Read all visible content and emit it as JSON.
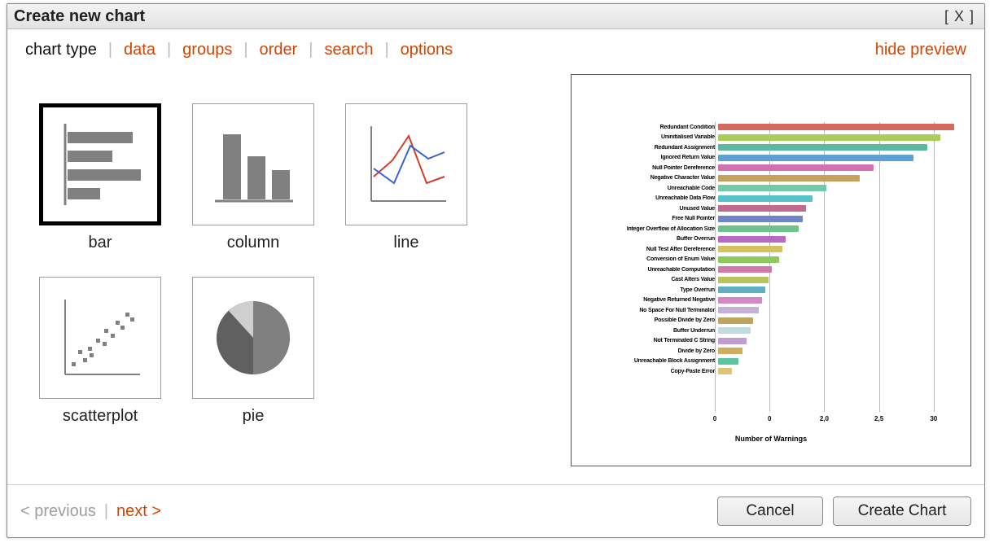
{
  "window": {
    "title": "Create new chart",
    "close_label": "[ X ]"
  },
  "tabs": {
    "items": [
      {
        "id": "chart-type",
        "label": "chart type",
        "active": true
      },
      {
        "id": "data",
        "label": "data"
      },
      {
        "id": "groups",
        "label": "groups"
      },
      {
        "id": "order",
        "label": "order"
      },
      {
        "id": "search",
        "label": "search"
      },
      {
        "id": "options",
        "label": "options"
      }
    ],
    "hide_preview": "hide preview"
  },
  "types": [
    {
      "id": "bar",
      "label": "bar",
      "selected": true
    },
    {
      "id": "column",
      "label": "column"
    },
    {
      "id": "line",
      "label": "line"
    },
    {
      "id": "scatterplot",
      "label": "scatterplot"
    },
    {
      "id": "pie",
      "label": "pie"
    }
  ],
  "nav": {
    "previous": "< previous",
    "next": "next >",
    "cancel": "Cancel",
    "create": "Create Chart"
  },
  "chart_data": {
    "type": "bar",
    "orientation": "horizontal",
    "xlabel": "Number of Warnings",
    "ylabel": "",
    "xlim": [
      0,
      35
    ],
    "xticks": [
      0,
      8,
      16,
      24,
      32
    ],
    "xtick_labels": [
      "0",
      "0",
      "2,0",
      "2,5",
      "30"
    ],
    "categories": [
      "Redundant Condition",
      "Uninitialised Variable",
      "Redundant Assignment",
      "Ignored Return Value",
      "Null Pointer Dereference",
      "Negative Character Value",
      "Unreachable Code",
      "Unreachable Data Flow",
      "Unused Value",
      "Free Null Pointer",
      "Integer Overflow of Allocation Size",
      "Buffer Overrun",
      "Null Test After Dereference",
      "Conversion of Enum Value",
      "Unreachable Computation",
      "Cast Alters Value",
      "Type Overrun",
      "Negative Returned Negative",
      "No Space For Null Terminator",
      "Possible Divide by Zero",
      "Buffer Underrun",
      "Not Terminated C String",
      "Divide by Zero",
      "Unreachable Block Assignment",
      "Copy-Paste Error"
    ],
    "values": [
      35,
      33,
      31,
      29,
      23,
      21,
      16,
      14,
      13,
      12.5,
      12,
      10,
      9.5,
      9,
      8,
      7.5,
      7,
      6.5,
      6,
      5.2,
      4.8,
      4.2,
      3.6,
      3.0,
      2.0
    ],
    "colors": [
      "#d36a5e",
      "#a7ce5b",
      "#5bb9a1",
      "#5ea0d3",
      "#d371b0",
      "#c6a25e",
      "#72caa8",
      "#59c1c8",
      "#c36a8f",
      "#6e86c9",
      "#6fc38a",
      "#b86ac0",
      "#d3c25e",
      "#8bca5b",
      "#cf7aa8",
      "#b8c55e",
      "#5cb0c0",
      "#d389c6",
      "#c5b0d8",
      "#bca55e",
      "#c1dbe0",
      "#c09ed1",
      "#cfac5e",
      "#5ec39f",
      "#e0c47a"
    ]
  }
}
